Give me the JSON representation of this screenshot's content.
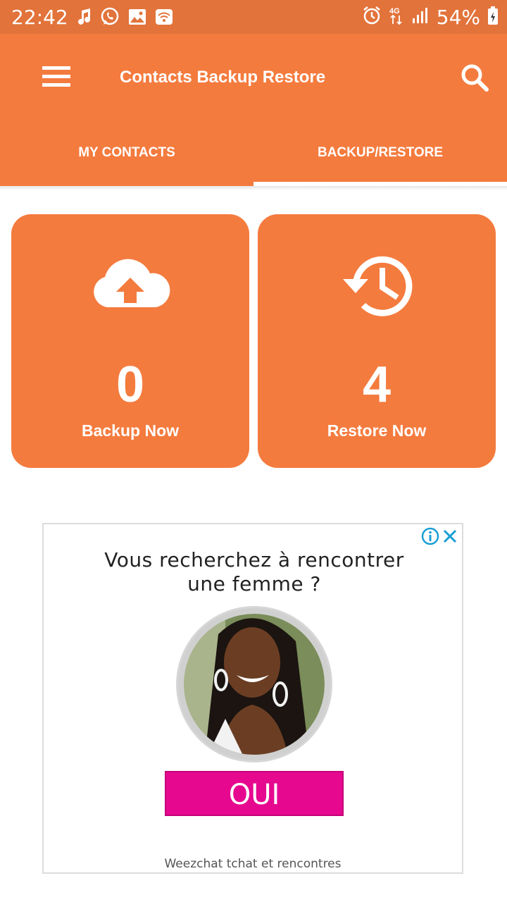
{
  "status_bar": {
    "time": "22:42",
    "battery_percent": "54%",
    "network": "4G",
    "icons_left": [
      "music-note-icon",
      "whatsapp-icon",
      "gallery-icon",
      "wifi-icon"
    ],
    "icons_right": [
      "alarm-icon",
      "network-4g-icon",
      "signal-icon",
      "battery-icon"
    ]
  },
  "app_bar": {
    "title": "Contacts Backup Restore",
    "menu_icon": "hamburger-menu-icon",
    "search_icon": "search-icon"
  },
  "tabs": [
    {
      "label": "MY CONTACTS",
      "selected": false
    },
    {
      "label": "BACKUP/RESTORE",
      "selected": true
    }
  ],
  "cards": {
    "backup": {
      "count": "0",
      "label": "Backup Now",
      "icon": "cloud-upload-icon"
    },
    "restore": {
      "count": "4",
      "label": "Restore Now",
      "icon": "history-restore-icon"
    }
  },
  "ad": {
    "headline_line1": "Vous recherchez à rencontrer",
    "headline_line2": "une femme ?",
    "cta_label": "OUI",
    "footer": "Weezchat tchat et rencontres",
    "info_icon": "ad-info-icon",
    "close_icon": "ad-close-icon"
  },
  "colors": {
    "accent": "#f47b3e",
    "status_bar": "#e2733b",
    "ad_cta": "#e6098f"
  }
}
